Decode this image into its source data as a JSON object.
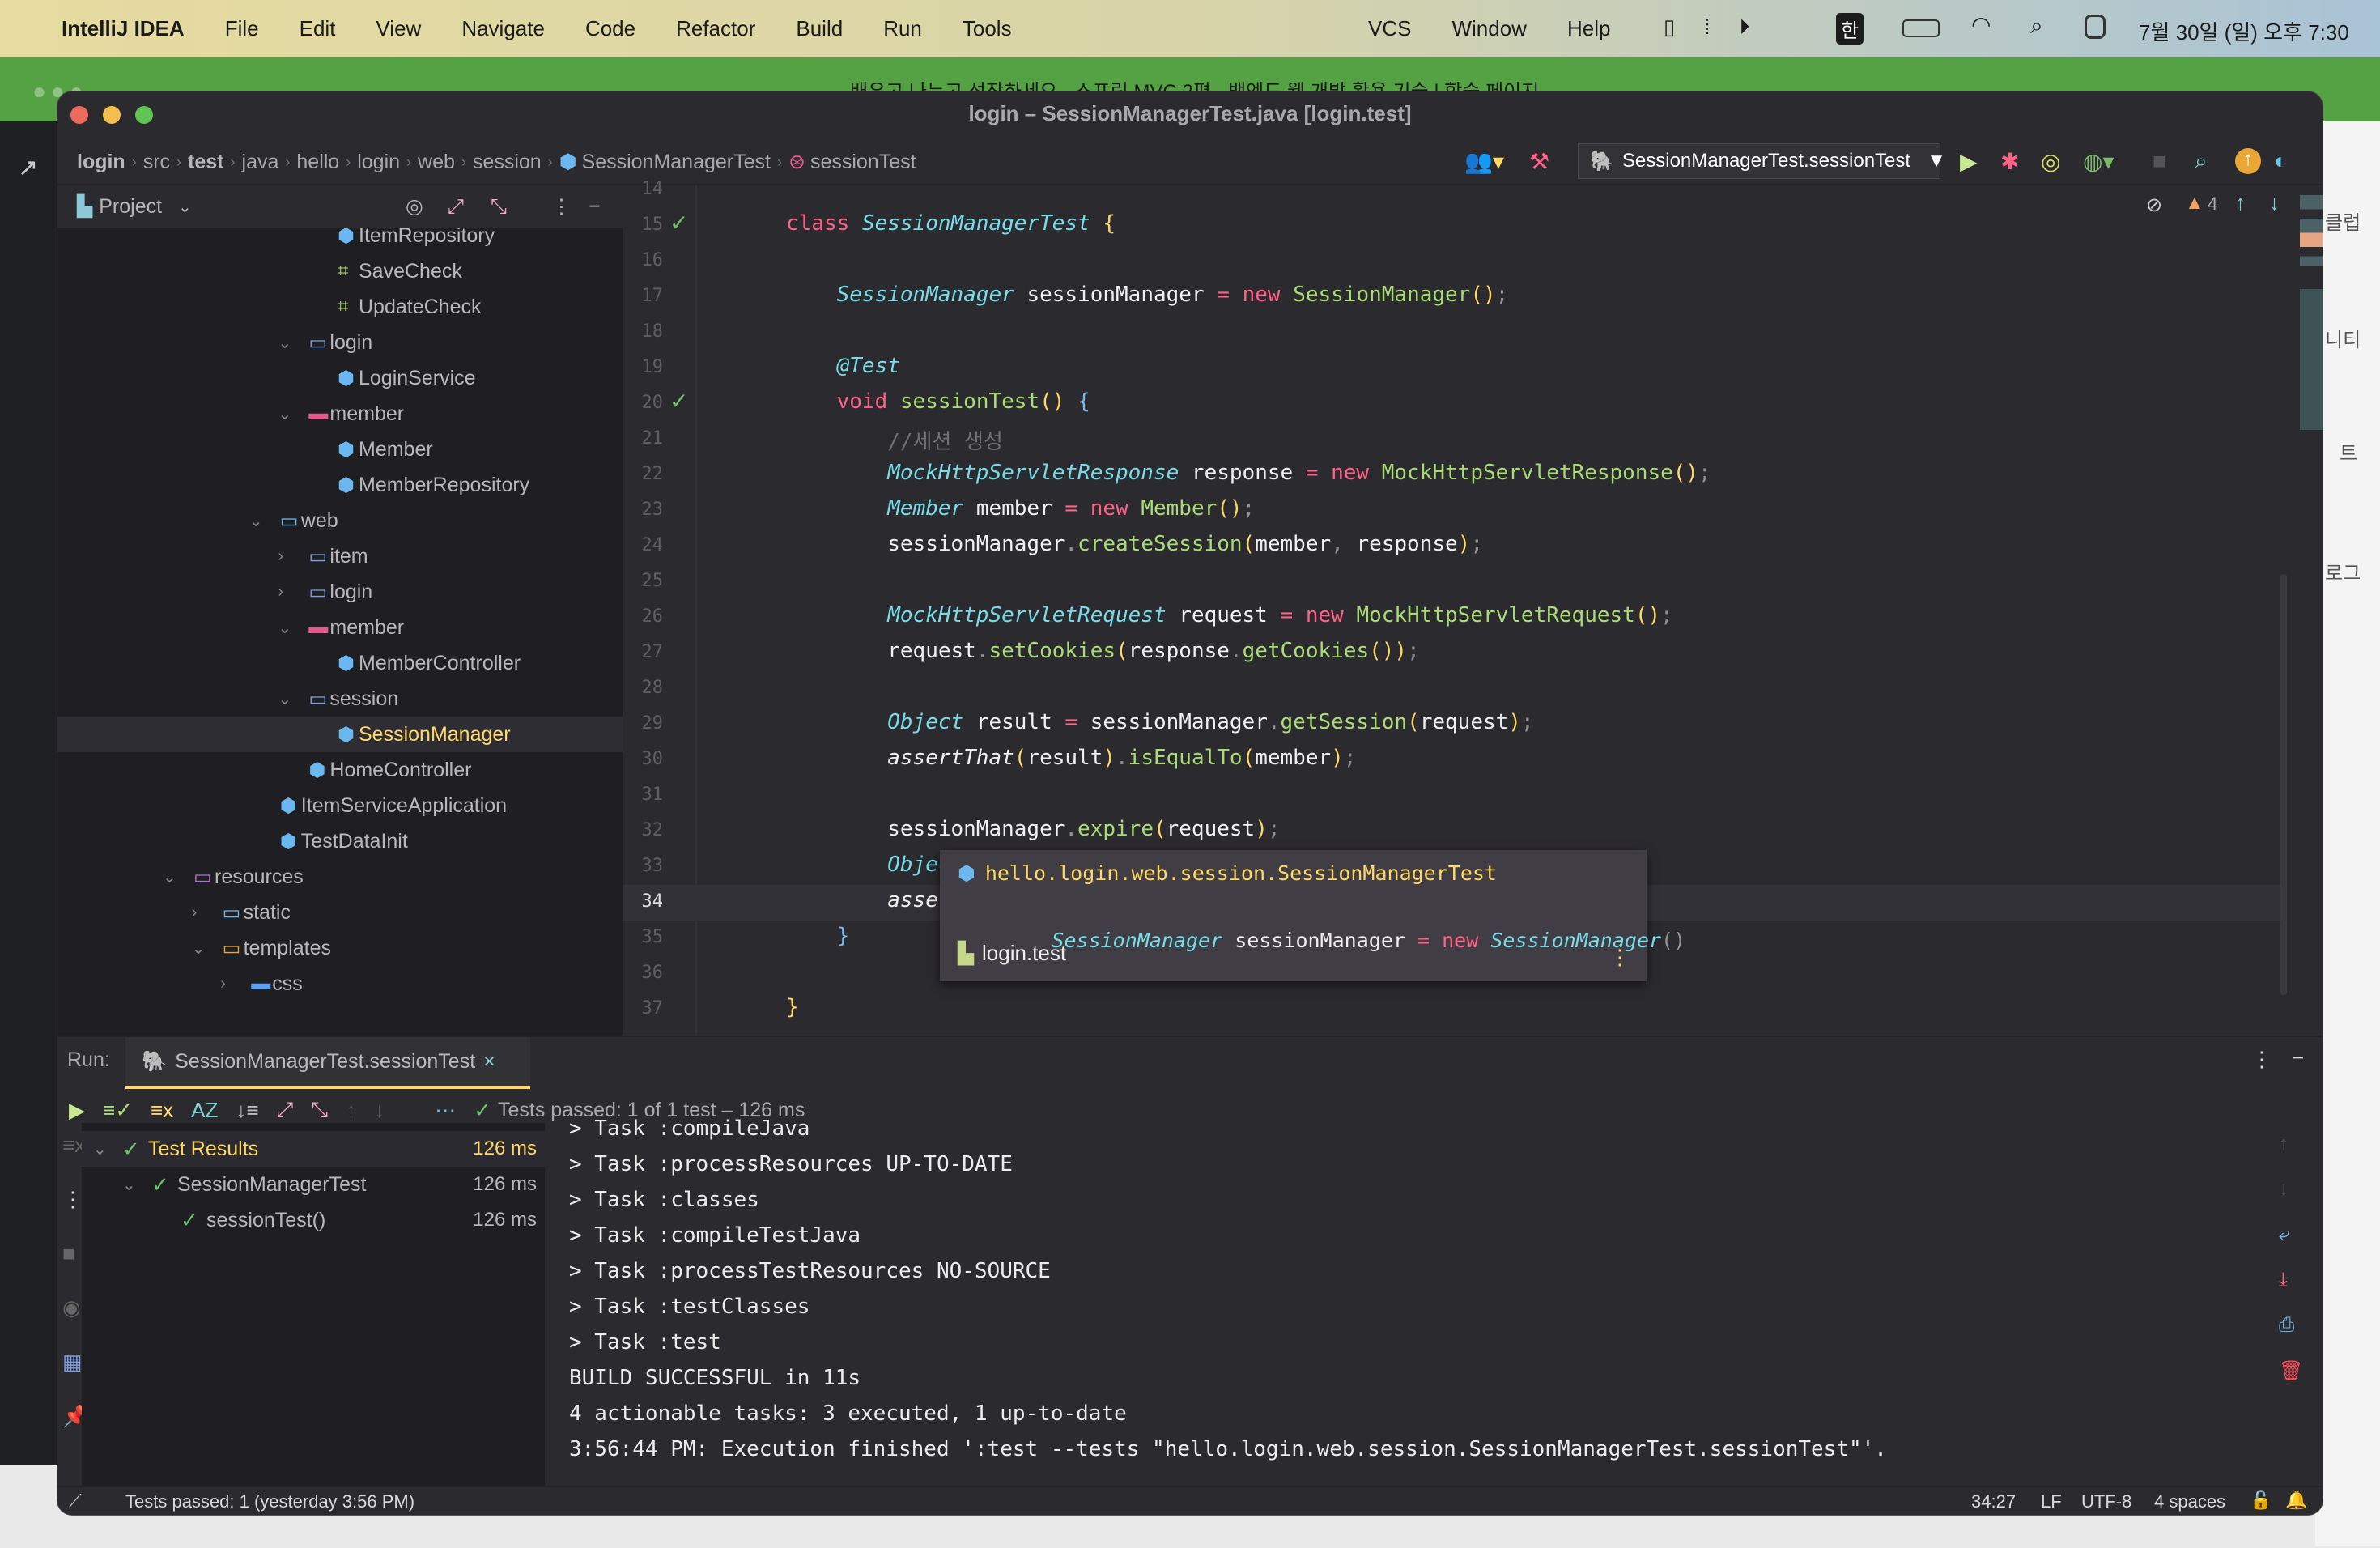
{
  "menubar": {
    "app": "IntelliJ IDEA",
    "items": [
      "File",
      "Edit",
      "View",
      "Navigate",
      "Code",
      "Refactor",
      "Build",
      "Run",
      "Tools"
    ],
    "items_right": [
      "VCS",
      "Window",
      "Help"
    ],
    "ime": "한",
    "clock": "7월 30일 (일) 오후 7:30"
  },
  "browser": {
    "tab_title": "배우고 나누고 성장하세요 - 스프링 MVC 2편 - 백엔드 웹 개발 활용 기술 | 학습 페이지",
    "side_labels": [
      "클럽",
      "니티",
      "트",
      "로그"
    ]
  },
  "window": {
    "title": "login – SessionManagerTest.java [login.test]",
    "breadcrumbs": [
      "login",
      "src",
      "test",
      "java",
      "hello",
      "login",
      "web",
      "session",
      "SessionManagerTest",
      "sessionTest"
    ],
    "run_config": "SessionManagerTest.sessionTest",
    "warnings": "4"
  },
  "project": {
    "title": "Project",
    "tree": [
      {
        "label": "ItemRepository",
        "level": 5,
        "icon": "class",
        "arrow": ""
      },
      {
        "label": "SaveCheck",
        "level": 5,
        "icon": "interface",
        "arrow": ""
      },
      {
        "label": "UpdateCheck",
        "level": 5,
        "icon": "interface",
        "arrow": ""
      },
      {
        "label": "login",
        "level": 4,
        "icon": "folder",
        "arrow": "down"
      },
      {
        "label": "LoginService",
        "level": 5,
        "icon": "class",
        "arrow": ""
      },
      {
        "label": "member",
        "level": 4,
        "icon": "folder-member",
        "arrow": "down"
      },
      {
        "label": "Member",
        "level": 5,
        "icon": "class",
        "arrow": ""
      },
      {
        "label": "MemberRepository",
        "level": 5,
        "icon": "class",
        "arrow": ""
      },
      {
        "label": "web",
        "level": 3,
        "icon": "folder-web",
        "arrow": "down"
      },
      {
        "label": "item",
        "level": 4,
        "icon": "folder",
        "arrow": "right"
      },
      {
        "label": "login",
        "level": 4,
        "icon": "folder",
        "arrow": "right"
      },
      {
        "label": "member",
        "level": 4,
        "icon": "folder-member",
        "arrow": "down"
      },
      {
        "label": "MemberController",
        "level": 5,
        "icon": "class",
        "arrow": ""
      },
      {
        "label": "session",
        "level": 4,
        "icon": "folder",
        "arrow": "down"
      },
      {
        "label": "SessionManager",
        "level": 5,
        "icon": "class",
        "arrow": "",
        "selected": true
      },
      {
        "label": "HomeController",
        "level": 4,
        "icon": "class",
        "arrow": ""
      },
      {
        "label": "ItemServiceApplication",
        "level": 3,
        "icon": "spring-app",
        "arrow": ""
      },
      {
        "label": "TestDataInit",
        "level": 3,
        "icon": "class",
        "arrow": ""
      },
      {
        "label": "resources",
        "level": 0,
        "icon": "folder-resources",
        "arrow": "down"
      },
      {
        "label": "static",
        "level": 1,
        "icon": "folder-web",
        "arrow": "right"
      },
      {
        "label": "templates",
        "level": 1,
        "icon": "folder-templates",
        "arrow": "down"
      },
      {
        "label": "css",
        "level": 2,
        "icon": "folder-css",
        "arrow": "right"
      }
    ]
  },
  "editor": {
    "lines": [
      {
        "n": "14",
        "t": []
      },
      {
        "n": "15",
        "t": [
          [
            "class ",
            "kw"
          ],
          [
            "SessionManagerTest ",
            "ty"
          ],
          [
            "{",
            "pn"
          ]
        ],
        "run": true
      },
      {
        "n": "16",
        "t": []
      },
      {
        "n": "17",
        "t": [
          [
            "    ",
            ""
          ],
          [
            "SessionManager ",
            "ty"
          ],
          [
            "sessionManager ",
            ""
          ],
          [
            "= ",
            "op"
          ],
          [
            "new ",
            "kw"
          ],
          [
            "SessionManager",
            "fn"
          ],
          [
            "()",
            "pn"
          ],
          [
            ";",
            "dim"
          ]
        ]
      },
      {
        "n": "18",
        "t": []
      },
      {
        "n": "19",
        "t": [
          [
            "    ",
            ""
          ],
          [
            "@Test",
            "an"
          ]
        ]
      },
      {
        "n": "20",
        "t": [
          [
            "    ",
            ""
          ],
          [
            "void ",
            "kw"
          ],
          [
            "sessionTest",
            "fn"
          ],
          [
            "() ",
            "pn"
          ],
          [
            "{",
            "br"
          ]
        ],
        "run": true
      },
      {
        "n": "21",
        "t": [
          [
            "        ",
            ""
          ],
          [
            "//세션 생성",
            "cm"
          ]
        ]
      },
      {
        "n": "22",
        "t": [
          [
            "        ",
            ""
          ],
          [
            "MockHttpServletResponse ",
            "ty"
          ],
          [
            "response ",
            ""
          ],
          [
            "= ",
            "op"
          ],
          [
            "new ",
            "kw"
          ],
          [
            "MockHttpServletResponse",
            "fn"
          ],
          [
            "()",
            "pn"
          ],
          [
            ";",
            "dim"
          ]
        ]
      },
      {
        "n": "23",
        "t": [
          [
            "        ",
            ""
          ],
          [
            "Member ",
            "ty"
          ],
          [
            "member ",
            ""
          ],
          [
            "= ",
            "op"
          ],
          [
            "new ",
            "kw"
          ],
          [
            "Member",
            "fn"
          ],
          [
            "()",
            "pn"
          ],
          [
            ";",
            "dim"
          ]
        ]
      },
      {
        "n": "24",
        "t": [
          [
            "        ",
            ""
          ],
          [
            "sessionManager",
            ""
          ],
          [
            ".",
            "dim"
          ],
          [
            "createSession",
            "fn"
          ],
          [
            "(",
            "pn"
          ],
          [
            "member",
            ""
          ],
          [
            ", ",
            "dim"
          ],
          [
            "response",
            ""
          ],
          [
            ")",
            "pn"
          ],
          [
            ";",
            "dim"
          ]
        ]
      },
      {
        "n": "25",
        "t": []
      },
      {
        "n": "26",
        "t": [
          [
            "        ",
            ""
          ],
          [
            "MockHttpServletRequest ",
            "ty"
          ],
          [
            "request ",
            ""
          ],
          [
            "= ",
            "op"
          ],
          [
            "new ",
            "kw"
          ],
          [
            "MockHttpServletRequest",
            "fn"
          ],
          [
            "()",
            "pn"
          ],
          [
            ";",
            "dim"
          ]
        ]
      },
      {
        "n": "27",
        "t": [
          [
            "        ",
            ""
          ],
          [
            "request",
            ""
          ],
          [
            ".",
            "dim"
          ],
          [
            "setCookies",
            "fn"
          ],
          [
            "(",
            "pn"
          ],
          [
            "response",
            ""
          ],
          [
            ".",
            "dim"
          ],
          [
            "getCookies",
            "fn"
          ],
          [
            "())",
            "pn"
          ],
          [
            ";",
            "dim"
          ]
        ]
      },
      {
        "n": "28",
        "t": []
      },
      {
        "n": "29",
        "t": [
          [
            "        ",
            ""
          ],
          [
            "Object ",
            "ty"
          ],
          [
            "result ",
            ""
          ],
          [
            "= ",
            "op"
          ],
          [
            "sessionManager",
            ""
          ],
          [
            ".",
            "dim"
          ],
          [
            "getSession",
            "fn"
          ],
          [
            "(",
            "pn"
          ],
          [
            "request",
            ""
          ],
          [
            ")",
            "pn"
          ],
          [
            ";",
            "dim"
          ]
        ]
      },
      {
        "n": "30",
        "t": [
          [
            "        ",
            ""
          ],
          [
            "assertThat",
            "it"
          ],
          [
            "(",
            "pn"
          ],
          [
            "result",
            ""
          ],
          [
            ")",
            "pn"
          ],
          [
            ".",
            "dim"
          ],
          [
            "isEqualTo",
            "fn"
          ],
          [
            "(",
            "pn"
          ],
          [
            "member",
            ""
          ],
          [
            ")",
            "pn"
          ],
          [
            ";",
            "dim"
          ]
        ]
      },
      {
        "n": "31",
        "t": []
      },
      {
        "n": "32",
        "t": [
          [
            "        ",
            ""
          ],
          [
            "sessionManager",
            ""
          ],
          [
            ".",
            "dim"
          ],
          [
            "expire",
            "fn"
          ],
          [
            "(",
            "pn"
          ],
          [
            "request",
            ""
          ],
          [
            ")",
            "pn"
          ],
          [
            ";",
            "dim"
          ]
        ]
      },
      {
        "n": "33",
        "t": [
          [
            "        ",
            ""
          ],
          [
            "Object ",
            "ty"
          ],
          [
            "e",
            ""
          ]
        ]
      },
      {
        "n": "34",
        "t": [
          [
            "        ",
            ""
          ],
          [
            "assertTh",
            "it"
          ]
        ],
        "current": true
      },
      {
        "n": "35",
        "t": [
          [
            "    ",
            ""
          ],
          [
            "}",
            "br"
          ]
        ]
      },
      {
        "n": "36",
        "t": []
      },
      {
        "n": "37",
        "t": [
          [
            "}",
            "pn"
          ]
        ]
      }
    ],
    "popup": {
      "class_name": "hello.login.web.session.SessionManagerTest",
      "field_type": "SessionManager",
      "field_name": "sessionManager",
      "eq": "=",
      "new_kw": "new",
      "ctor": "SessionManager",
      "parens": "()",
      "module": "login.test"
    }
  },
  "run": {
    "label": "Run:",
    "tab": "SessionManagerTest.sessionTest",
    "summary": "Tests passed: 1 of 1 test – 126 ms",
    "tests": [
      {
        "label": "Test Results",
        "time": "126 ms",
        "level": 0
      },
      {
        "label": "SessionManagerTest",
        "time": "126 ms",
        "level": 1
      },
      {
        "label": "sessionTest()",
        "time": "126 ms",
        "level": 2
      }
    ],
    "console": [
      "> Task :compileJava",
      "> Task :processResources UP-TO-DATE",
      "> Task :classes",
      "> Task :compileTestJava",
      "> Task :processTestResources NO-SOURCE",
      "> Task :testClasses",
      "> Task :test",
      "BUILD SUCCESSFUL in 11s",
      "4 actionable tasks: 3 executed, 1 up-to-date",
      "3:56:44 PM: Execution finished ':test --tests \"hello.login.web.session.SessionManagerTest.sessionTest\"'."
    ]
  },
  "status": {
    "message": "Tests passed: 1 (yesterday 3:56 PM)",
    "position": "34:27",
    "line_sep": "LF",
    "encoding": "UTF-8",
    "indent": "4 spaces"
  },
  "colors": {
    "accent": "#ffd866",
    "keyword": "#ff6188",
    "type": "#78dce8",
    "function": "#a9dc76",
    "pass": "#6cc36c"
  }
}
